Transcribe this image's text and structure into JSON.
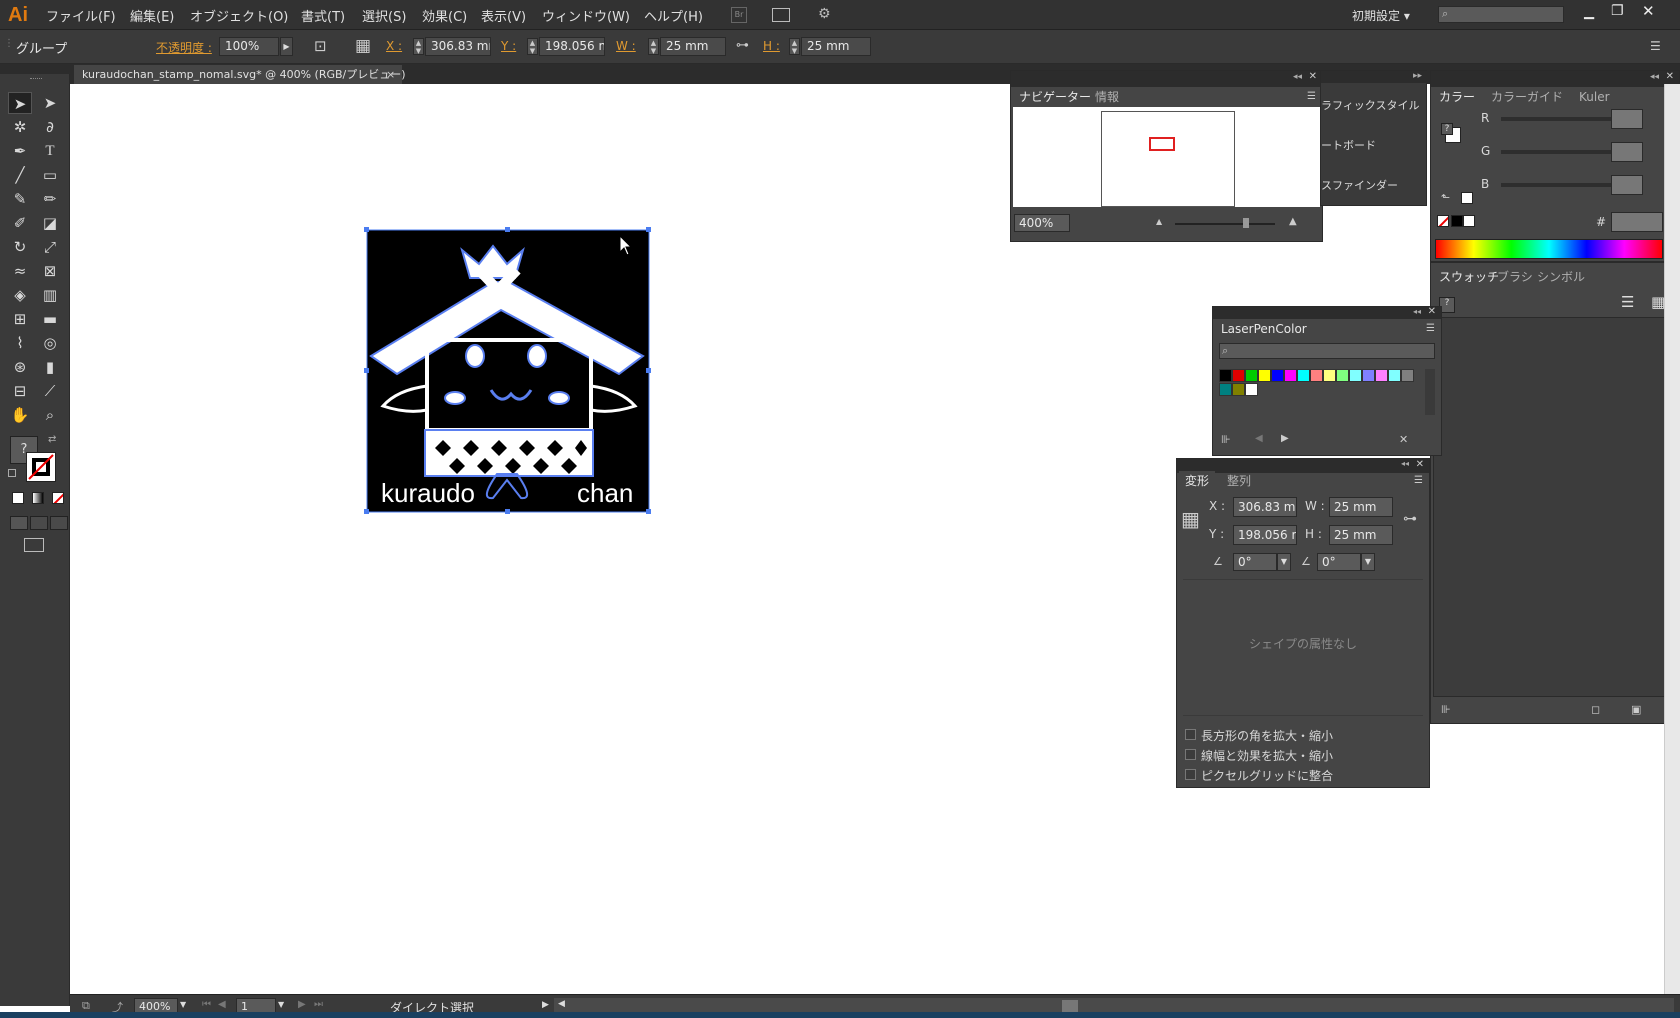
{
  "app": {
    "logo": "Ai"
  },
  "menu": [
    "ファイル(F)",
    "編集(E)",
    "オブジェクト(O)",
    "書式(T)",
    "選択(S)",
    "効果(C)",
    "表示(V)",
    "ウィンドウ(W)",
    "ヘルプ(H)"
  ],
  "menu_right": {
    "workspace": "初期設定 ▾",
    "bridge": "Br"
  },
  "control": {
    "selection_type": "グループ",
    "opacity_label": "不透明度 :",
    "opacity_value": "100%",
    "x_label": "X :",
    "x_value": "306.83 mm",
    "y_label": "Y :",
    "y_value": "198.056 mm",
    "w_label": "W :",
    "w_value": "25 mm",
    "h_label": "H :",
    "h_value": "25 mm"
  },
  "document": {
    "tab_title": "kuraudochan_stamp_nomal.svg* @ 400% (RGB/プレビュー)",
    "close": "×"
  },
  "artwork": {
    "word1": "kuraudo",
    "word2": "chan"
  },
  "navigator": {
    "tabs": [
      "ナビゲーター",
      "情報"
    ],
    "zoom": "400%"
  },
  "collapsed_panels": [
    "ラフィックスタイル",
    "ートボード",
    "スファインダー"
  ],
  "color_panel": {
    "tabs": [
      "カラー",
      "カラーガイド",
      "Kuler"
    ],
    "channels": [
      "R",
      "G",
      "B"
    ],
    "hex_label": "#"
  },
  "swatches_panel": {
    "tabs": [
      "スウォッチ",
      "ブラシ",
      "シンボル"
    ]
  },
  "laserpen": {
    "title": "LaserPenColor",
    "colors": [
      "#000000",
      "#e00000",
      "#00cc00",
      "#ffff00",
      "#0000ff",
      "#ff00ff",
      "#00ffff",
      "#ff8080",
      "#ffff80",
      "#80ff80",
      "#80ffff",
      "#8080ff",
      "#ff80ff",
      "#80ffff",
      "#808080",
      "#008080",
      "#808000",
      "#ffffff"
    ]
  },
  "transform": {
    "tabs": [
      "変形",
      "整列"
    ],
    "x_label": "X :",
    "x_value": "306.83 mm",
    "y_label": "Y :",
    "y_value": "198.056 m",
    "w_label": "W :",
    "w_value": "25 mm",
    "h_label": "H :",
    "h_value": "25 mm",
    "angle_value": "0°",
    "shear_value": "0°",
    "no_shape": "シェイプの属性なし",
    "options": [
      "長方形の角を拡大・縮小",
      "線幅と効果を拡大・縮小",
      "ピクセルグリッドに整合"
    ]
  },
  "status": {
    "zoom": "400%",
    "artboard": "1",
    "tool": "ダイレクト選択"
  }
}
